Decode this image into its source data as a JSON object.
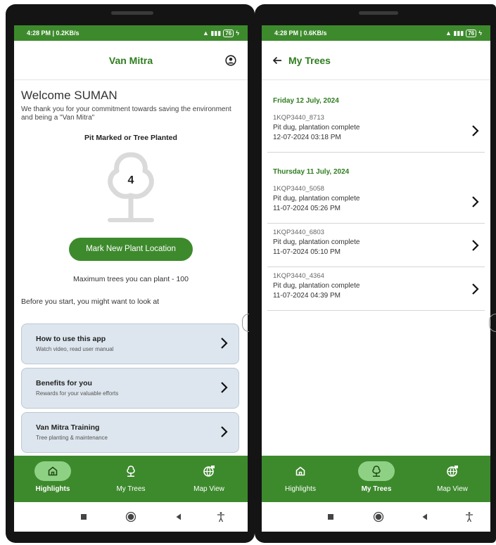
{
  "left": {
    "status": {
      "time": "4:28 PM | 0.2KB/s",
      "battery": "76"
    },
    "appbar": {
      "title": "Van Mitra"
    },
    "welcome": "Welcome SUMAN",
    "thanks": "We thank you for your commitment towards saving the environment and being a \"Van Mitra\"",
    "pit_title": "Pit Marked or Tree Planted",
    "tree_count": "4",
    "mark_button": "Mark New Plant Location",
    "max_trees": "Maximum trees you can plant - 100",
    "before_text": "Before you start, you might want to look at",
    "cards": [
      {
        "title": "How to use this app",
        "subtitle": "Watch video, read user manual"
      },
      {
        "title": "Benefits for you",
        "subtitle": "Rewards for your valuable efforts"
      },
      {
        "title": "Van Mitra Training",
        "subtitle": "Tree planting & maintenance"
      }
    ],
    "nav": [
      {
        "label": "Highlights",
        "icon": "home-icon",
        "active": true
      },
      {
        "label": "My Trees",
        "icon": "tree-icon",
        "active": false
      },
      {
        "label": "Map View",
        "icon": "globe-icon",
        "active": false
      }
    ]
  },
  "right": {
    "status": {
      "time": "4:28 PM | 0.6KB/s",
      "battery": "76"
    },
    "appbar": {
      "title": "My Trees"
    },
    "groups": [
      {
        "date": "Friday 12 July, 2024",
        "items": [
          {
            "id": "1KQP3440_8713",
            "status": "Pit dug, plantation complete",
            "time": "12-07-2024 03:18 PM"
          }
        ]
      },
      {
        "date": "Thursday 11 July, 2024",
        "items": [
          {
            "id": "1KQP3440_5058",
            "status": "Pit dug, plantation complete",
            "time": "11-07-2024 05:26 PM"
          },
          {
            "id": "1KQP3440_6803",
            "status": "Pit dug, plantation complete",
            "time": "11-07-2024 05:10 PM"
          },
          {
            "id": "1KQP3440_4364",
            "status": "Pit dug, plantation complete",
            "time": "11-07-2024 04:39 PM"
          }
        ]
      }
    ],
    "nav": [
      {
        "label": "Highlights",
        "icon": "home-icon",
        "active": false
      },
      {
        "label": "My Trees",
        "icon": "tree-icon",
        "active": true
      },
      {
        "label": "Map View",
        "icon": "globe-icon",
        "active": false
      }
    ]
  },
  "colors": {
    "primary": "#3d8a2d",
    "title_green": "#2e7d1f",
    "active_pill": "#8fd184",
    "card_bg": "#dde6ee"
  }
}
